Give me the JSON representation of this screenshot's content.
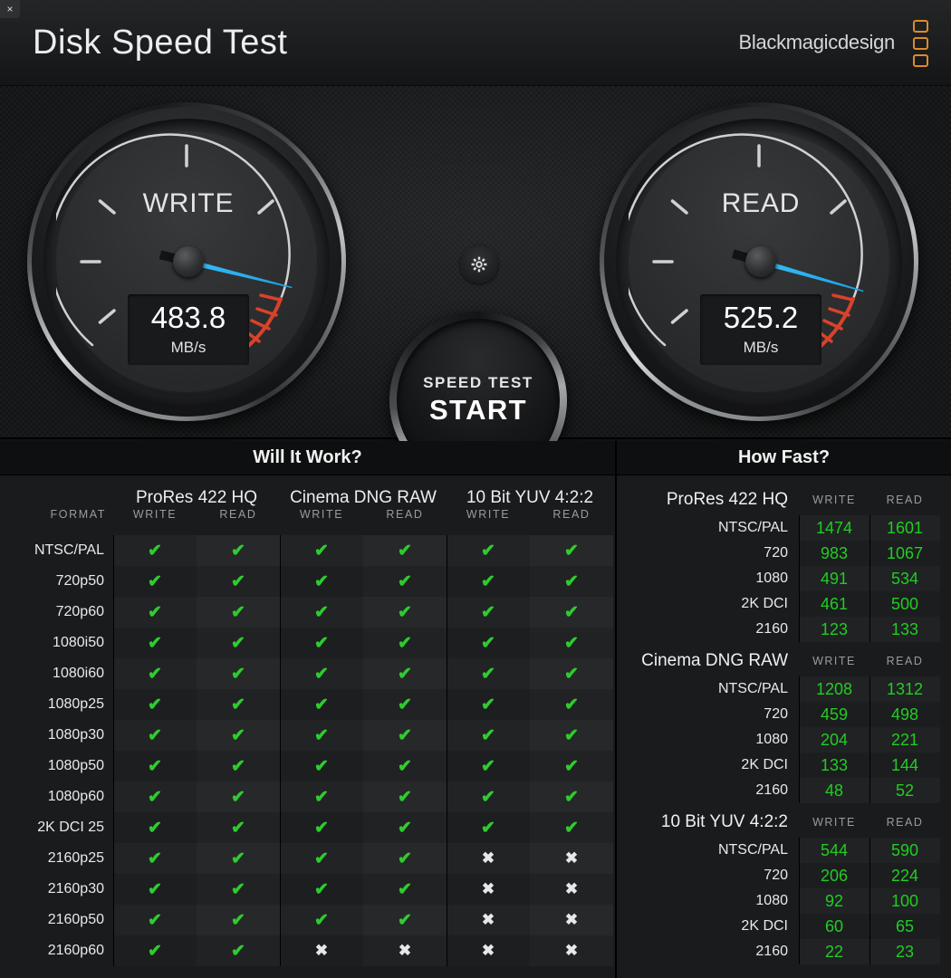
{
  "window": {
    "close_label": "×"
  },
  "header": {
    "title": "Disk Speed Test",
    "brand": "Blackmagicdesign",
    "logo_icon": "blackmagic-logo-icon"
  },
  "colors": {
    "accent_green": "#22cc22",
    "needle_blue": "#2fb5f2",
    "red_zone": "#d9422b",
    "brand_orange": "#e08a28"
  },
  "gauges": {
    "write": {
      "label": "WRITE",
      "value": "483.8",
      "unit": "MB/s",
      "angle_deg": 14
    },
    "read": {
      "label": "READ",
      "value": "525.2",
      "unit": "MB/s",
      "angle_deg": 16
    }
  },
  "controls": {
    "gear_icon": "gear-icon",
    "start_line1": "SPEED TEST",
    "start_line2": "START"
  },
  "will_it_work": {
    "title": "Will It Work?",
    "format_header": "FORMAT",
    "groups": [
      {
        "name": "ProRes 422 HQ",
        "write_label": "WRITE",
        "read_label": "READ"
      },
      {
        "name": "Cinema DNG RAW",
        "write_label": "WRITE",
        "read_label": "READ"
      },
      {
        "name": "10 Bit YUV 4:2:2",
        "write_label": "WRITE",
        "read_label": "READ"
      }
    ],
    "check_glyph": "✔",
    "cross_glyph": "✖",
    "rows": [
      {
        "format": "NTSC/PAL",
        "cells": [
          "ok",
          "ok",
          "ok",
          "ok",
          "ok",
          "ok"
        ]
      },
      {
        "format": "720p50",
        "cells": [
          "ok",
          "ok",
          "ok",
          "ok",
          "ok",
          "ok"
        ]
      },
      {
        "format": "720p60",
        "cells": [
          "ok",
          "ok",
          "ok",
          "ok",
          "ok",
          "ok"
        ]
      },
      {
        "format": "1080i50",
        "cells": [
          "ok",
          "ok",
          "ok",
          "ok",
          "ok",
          "ok"
        ]
      },
      {
        "format": "1080i60",
        "cells": [
          "ok",
          "ok",
          "ok",
          "ok",
          "ok",
          "ok"
        ]
      },
      {
        "format": "1080p25",
        "cells": [
          "ok",
          "ok",
          "ok",
          "ok",
          "ok",
          "ok"
        ]
      },
      {
        "format": "1080p30",
        "cells": [
          "ok",
          "ok",
          "ok",
          "ok",
          "ok",
          "ok"
        ]
      },
      {
        "format": "1080p50",
        "cells": [
          "ok",
          "ok",
          "ok",
          "ok",
          "ok",
          "ok"
        ]
      },
      {
        "format": "1080p60",
        "cells": [
          "ok",
          "ok",
          "ok",
          "ok",
          "ok",
          "ok"
        ]
      },
      {
        "format": "2K DCI 25",
        "cells": [
          "ok",
          "ok",
          "ok",
          "ok",
          "ok",
          "ok"
        ]
      },
      {
        "format": "2160p25",
        "cells": [
          "ok",
          "ok",
          "ok",
          "ok",
          "no",
          "no"
        ]
      },
      {
        "format": "2160p30",
        "cells": [
          "ok",
          "ok",
          "ok",
          "ok",
          "no",
          "no"
        ]
      },
      {
        "format": "2160p50",
        "cells": [
          "ok",
          "ok",
          "ok",
          "ok",
          "no",
          "no"
        ]
      },
      {
        "format": "2160p60",
        "cells": [
          "ok",
          "ok",
          "no",
          "no",
          "no",
          "no"
        ]
      }
    ]
  },
  "how_fast": {
    "title": "How Fast?",
    "groups": [
      {
        "name": "ProRes 422 HQ",
        "write_label": "WRITE",
        "read_label": "READ",
        "rows": [
          {
            "format": "NTSC/PAL",
            "write": "1474",
            "read": "1601"
          },
          {
            "format": "720",
            "write": "983",
            "read": "1067"
          },
          {
            "format": "1080",
            "write": "491",
            "read": "534"
          },
          {
            "format": "2K DCI",
            "write": "461",
            "read": "500"
          },
          {
            "format": "2160",
            "write": "123",
            "read": "133"
          }
        ]
      },
      {
        "name": "Cinema DNG RAW",
        "write_label": "WRITE",
        "read_label": "READ",
        "rows": [
          {
            "format": "NTSC/PAL",
            "write": "1208",
            "read": "1312"
          },
          {
            "format": "720",
            "write": "459",
            "read": "498"
          },
          {
            "format": "1080",
            "write": "204",
            "read": "221"
          },
          {
            "format": "2K DCI",
            "write": "133",
            "read": "144"
          },
          {
            "format": "2160",
            "write": "48",
            "read": "52"
          }
        ]
      },
      {
        "name": "10 Bit YUV 4:2:2",
        "write_label": "WRITE",
        "read_label": "READ",
        "rows": [
          {
            "format": "NTSC/PAL",
            "write": "544",
            "read": "590"
          },
          {
            "format": "720",
            "write": "206",
            "read": "224"
          },
          {
            "format": "1080",
            "write": "92",
            "read": "100"
          },
          {
            "format": "2K DCI",
            "write": "60",
            "read": "65"
          },
          {
            "format": "2160",
            "write": "22",
            "read": "23"
          }
        ]
      }
    ]
  }
}
